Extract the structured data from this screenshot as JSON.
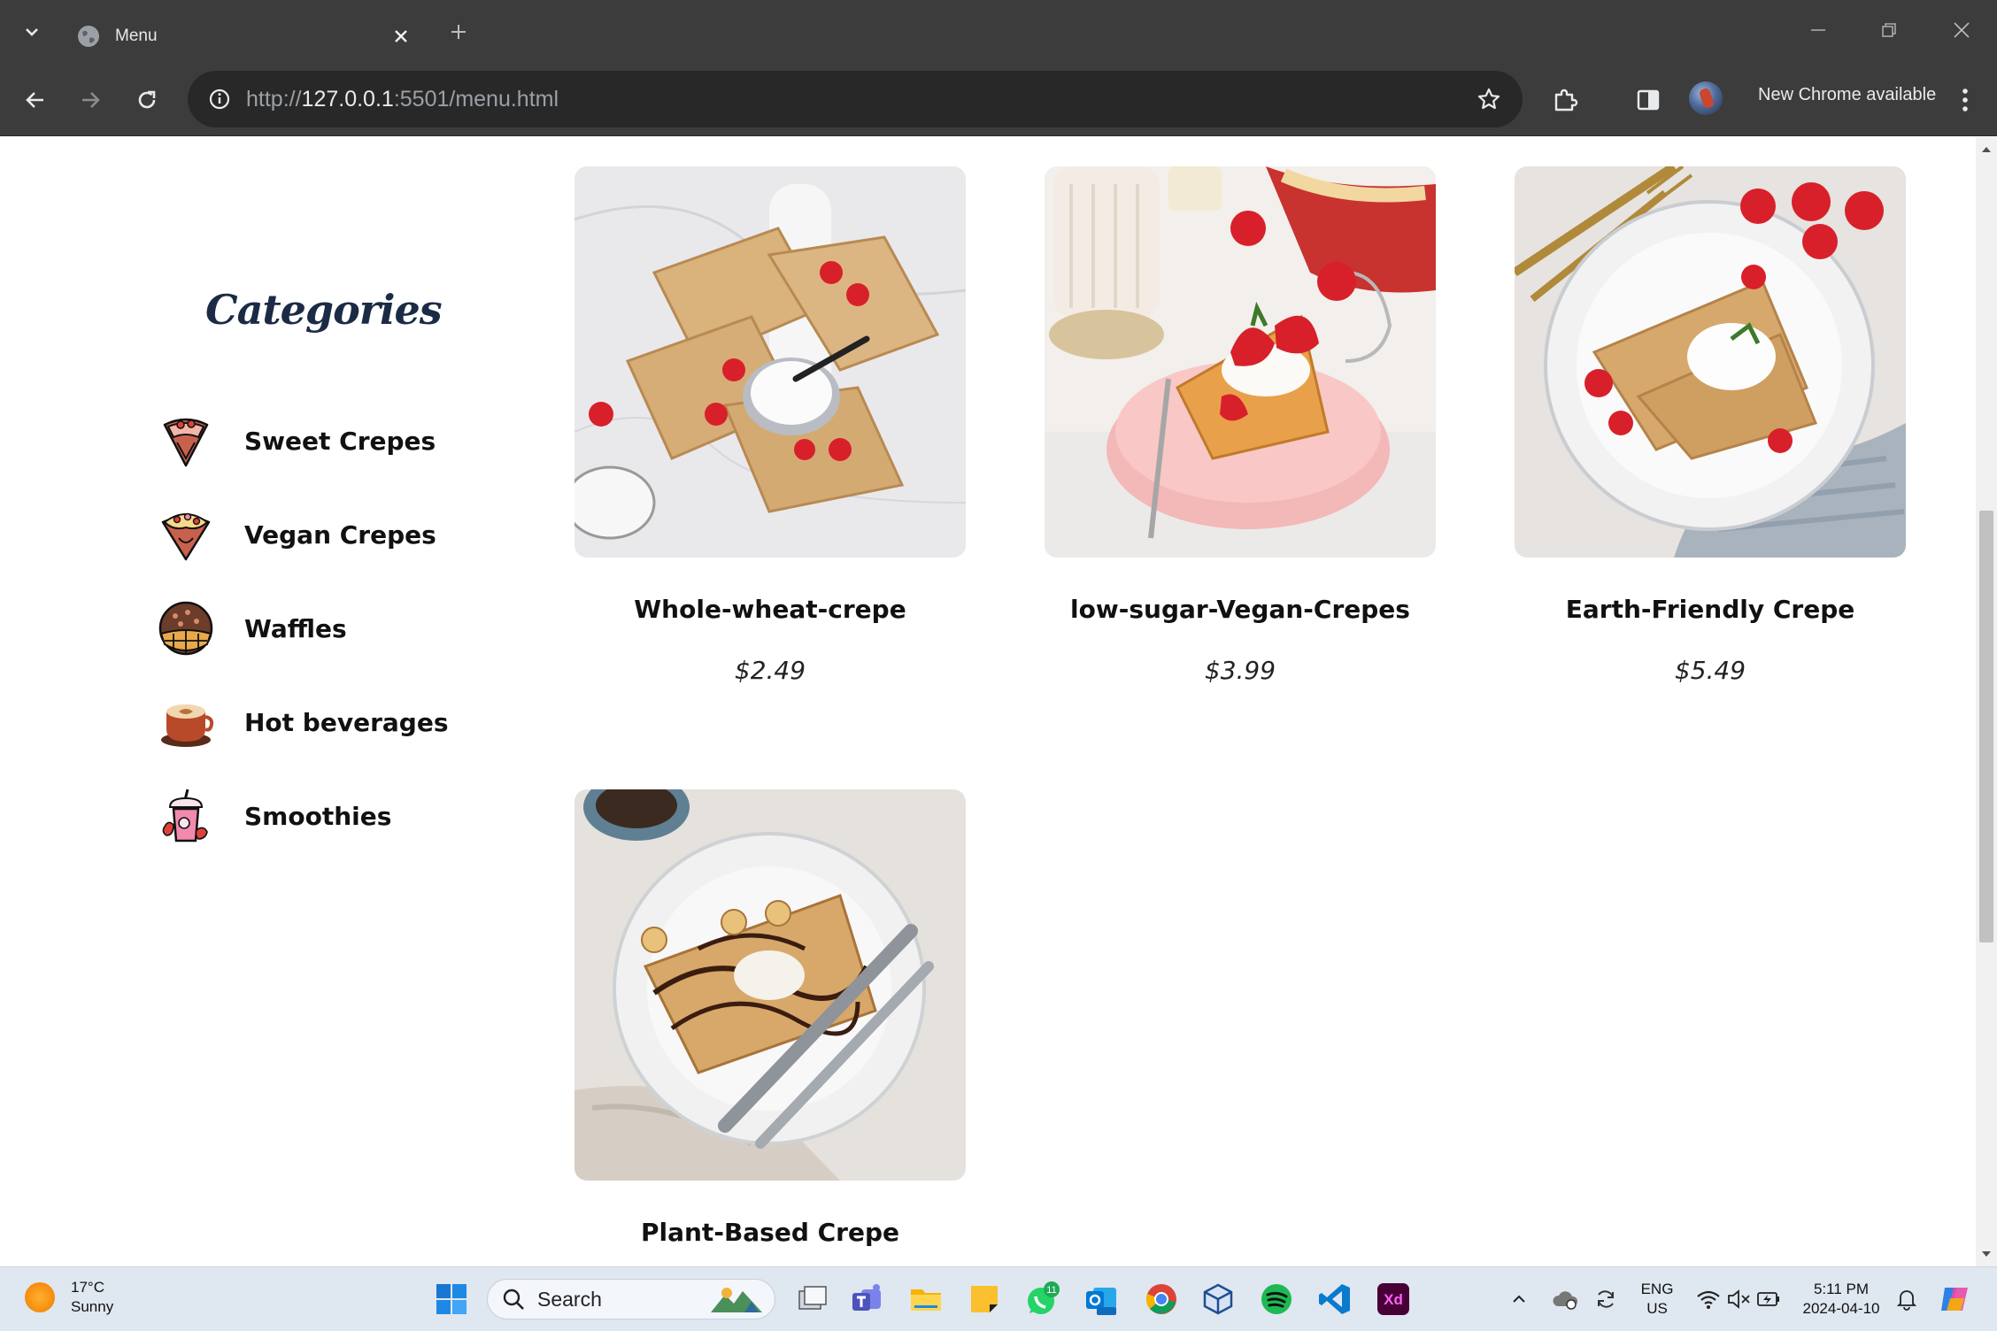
{
  "browser": {
    "tab_title": "Menu",
    "url_scheme": "http://",
    "url_host": "127.0.0.1",
    "url_path": ":5501/menu.html",
    "update_label": "New Chrome available"
  },
  "sidebar": {
    "title": "Categories",
    "items": [
      {
        "label": "Sweet Crepes",
        "icon": "sweet-crepe-icon"
      },
      {
        "label": "Vegan Crepes",
        "icon": "vegan-crepe-icon"
      },
      {
        "label": "Waffles",
        "icon": "waffle-icon"
      },
      {
        "label": "Hot beverages",
        "icon": "coffee-cup-icon"
      },
      {
        "label": "Smoothies",
        "icon": "smoothie-icon"
      }
    ]
  },
  "products": [
    {
      "name": "Whole-wheat-crepe",
      "price": "$2.49"
    },
    {
      "name": "low-sugar-Vegan-Crepes",
      "price": "$3.99"
    },
    {
      "name": "Earth-Friendly Crepe",
      "price": "$5.49"
    },
    {
      "name": "Plant-Based Crepe",
      "price": ""
    }
  ],
  "taskbar": {
    "weather_temp": "17°C",
    "weather_desc": "Sunny",
    "search_label": "Search",
    "whatsapp_badge": "11",
    "lang_primary": "ENG",
    "lang_secondary": "US",
    "time": "5:11 PM",
    "date": "2024-04-10"
  },
  "colors": {
    "chrome_dark": "#3c3c3c",
    "heading_navy": "#1c2b45",
    "taskbar_bg": "#dfe7f1"
  }
}
